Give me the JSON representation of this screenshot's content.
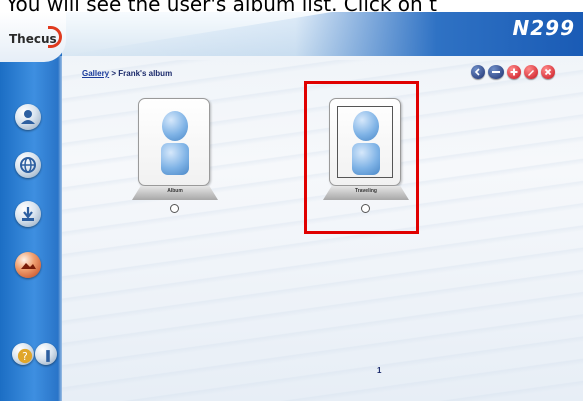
{
  "caption": "You will see the user's album list. Click on t",
  "header": {
    "logo_text": "Thecus",
    "model": "N299"
  },
  "breadcrumb": {
    "gallery_link": "Gallery",
    "separator": " > ",
    "current": "Frank's album"
  },
  "toolbar": {
    "buttons": [
      "back-icon",
      "minus-icon",
      "add-icon",
      "edit-icon",
      "delete-icon"
    ]
  },
  "sidebar": {
    "items": [
      "user-icon",
      "globe-icon",
      "download-icon",
      "gallery-icon",
      "help-icon",
      "info-icon"
    ]
  },
  "albums": [
    {
      "label": "Album"
    },
    {
      "label": "Traveling"
    }
  ],
  "pagination": {
    "page": "1"
  },
  "colors": {
    "sidebar": "#2b7fd6",
    "highlight": "#e00000",
    "model_bg": "#1a5bb5"
  }
}
